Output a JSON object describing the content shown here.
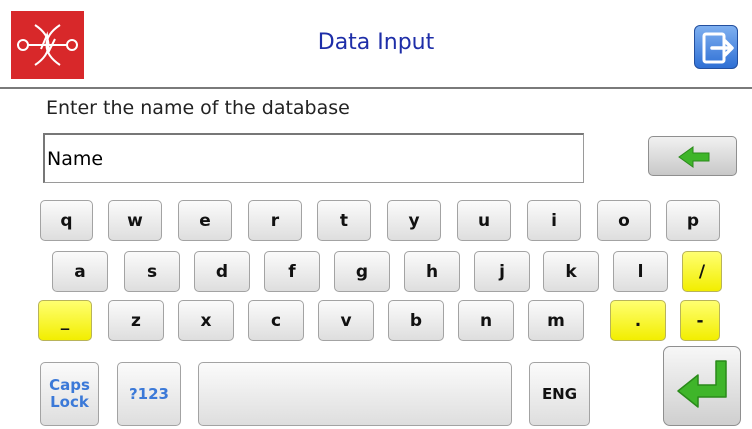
{
  "header": {
    "title": "Data Input",
    "logo_icon": "wave-logo-icon",
    "exit_icon": "exit-door-icon"
  },
  "form": {
    "prompt": "Enter the name of the database",
    "name_value": "Name"
  },
  "keyboard": {
    "row1": [
      "q",
      "w",
      "e",
      "r",
      "t",
      "y",
      "u",
      "i",
      "o",
      "p"
    ],
    "row2": [
      "a",
      "s",
      "d",
      "f",
      "g",
      "h",
      "j",
      "k",
      "l",
      "/"
    ],
    "row3": [
      "_",
      "z",
      "x",
      "c",
      "v",
      "b",
      "n",
      "m",
      ".",
      "-"
    ],
    "caps_line1": "Caps",
    "caps_line2": "Lock",
    "symbols": "?123",
    "space": "",
    "lang": "ENG"
  },
  "colors": {
    "logo_bg": "#d8282a",
    "title": "#1e2ea8",
    "accent_key": "#f2ee00",
    "arrow_green": "#3fb52a",
    "exit_blue": "#2e6fd4"
  }
}
